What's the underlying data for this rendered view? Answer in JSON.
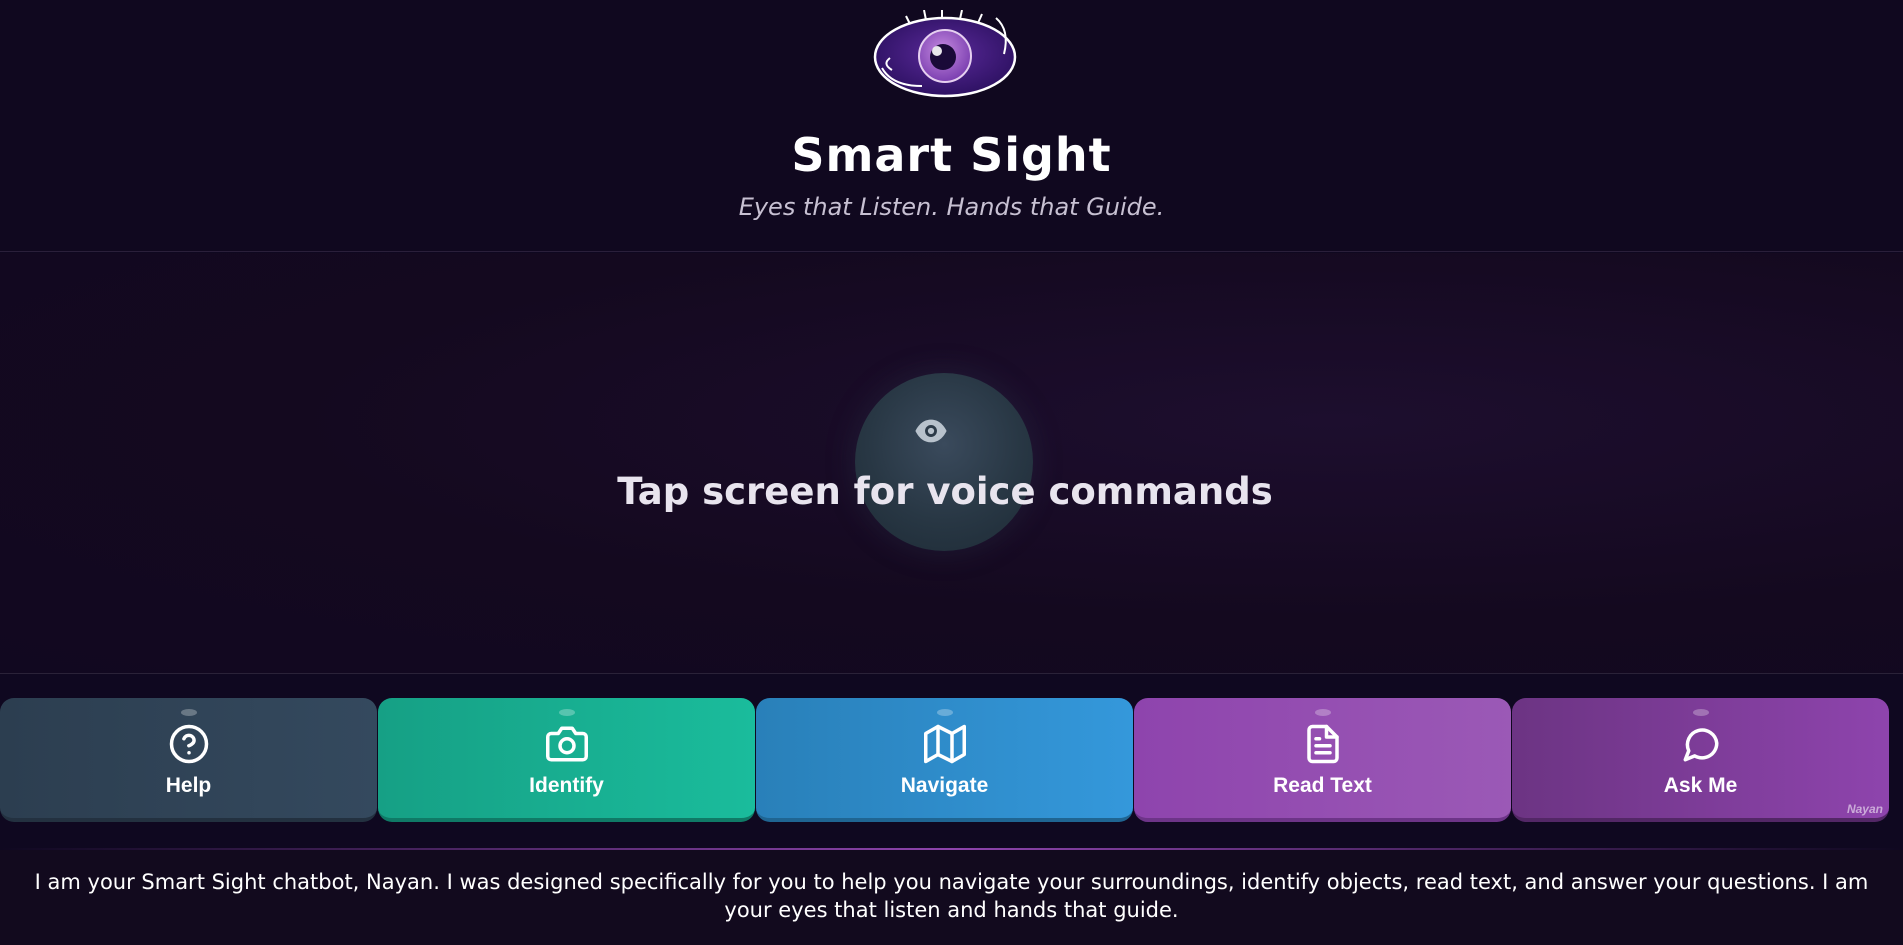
{
  "header": {
    "logo_icon": "eye-logo-icon",
    "title": "Smart Sight",
    "tagline": "Eyes that Listen. Hands that Guide."
  },
  "main": {
    "orb_icon": "eye-icon",
    "prompt": "Tap screen for voice commands"
  },
  "actions": [
    {
      "label": "Help",
      "icon": "help-circle-icon",
      "color": "#34495e"
    },
    {
      "label": "Identify",
      "icon": "camera-icon",
      "color": "#1abc9c"
    },
    {
      "label": "Navigate",
      "icon": "map-icon",
      "color": "#3498db"
    },
    {
      "label": "Read Text",
      "icon": "document-icon",
      "color": "#9b59b6"
    },
    {
      "label": "Ask Me",
      "icon": "chat-bubble-icon",
      "color": "#8e44ad"
    }
  ],
  "signature": "Nayan",
  "footer": {
    "intro": "I am your Smart Sight chatbot, Nayan. I was designed specifically for you to help you navigate your surroundings, identify objects, read text, and answer your questions. I am your eyes that listen and hands that guide."
  },
  "colors": {
    "background": "#10081f",
    "accent": "#8e44ad"
  }
}
